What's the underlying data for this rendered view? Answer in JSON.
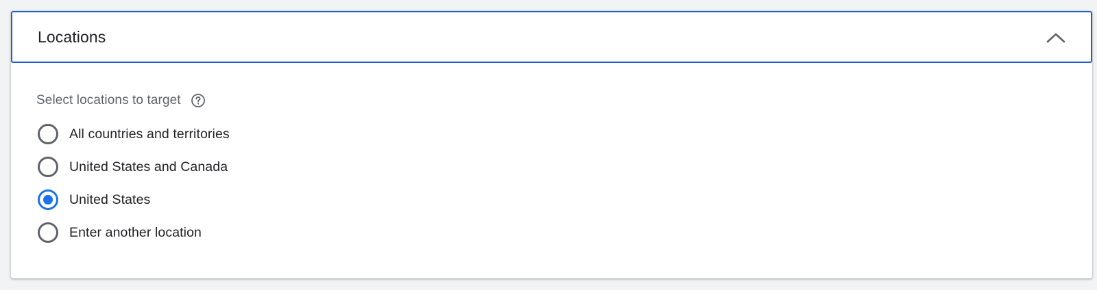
{
  "panel": {
    "title": "Locations",
    "collapse_icon": "chevron-up-icon",
    "accent_color": "#1a5fcc"
  },
  "targeting": {
    "subtitle": "Select locations to target",
    "help_icon": "help-circle-icon",
    "selected_index": 2,
    "options": [
      {
        "label": "All countries and territories",
        "checked": false
      },
      {
        "label": "United States and Canada",
        "checked": false
      },
      {
        "label": "United States",
        "checked": true
      },
      {
        "label": "Enter another location",
        "checked": false
      }
    ],
    "radio_selected_color": "#1a73e8"
  }
}
